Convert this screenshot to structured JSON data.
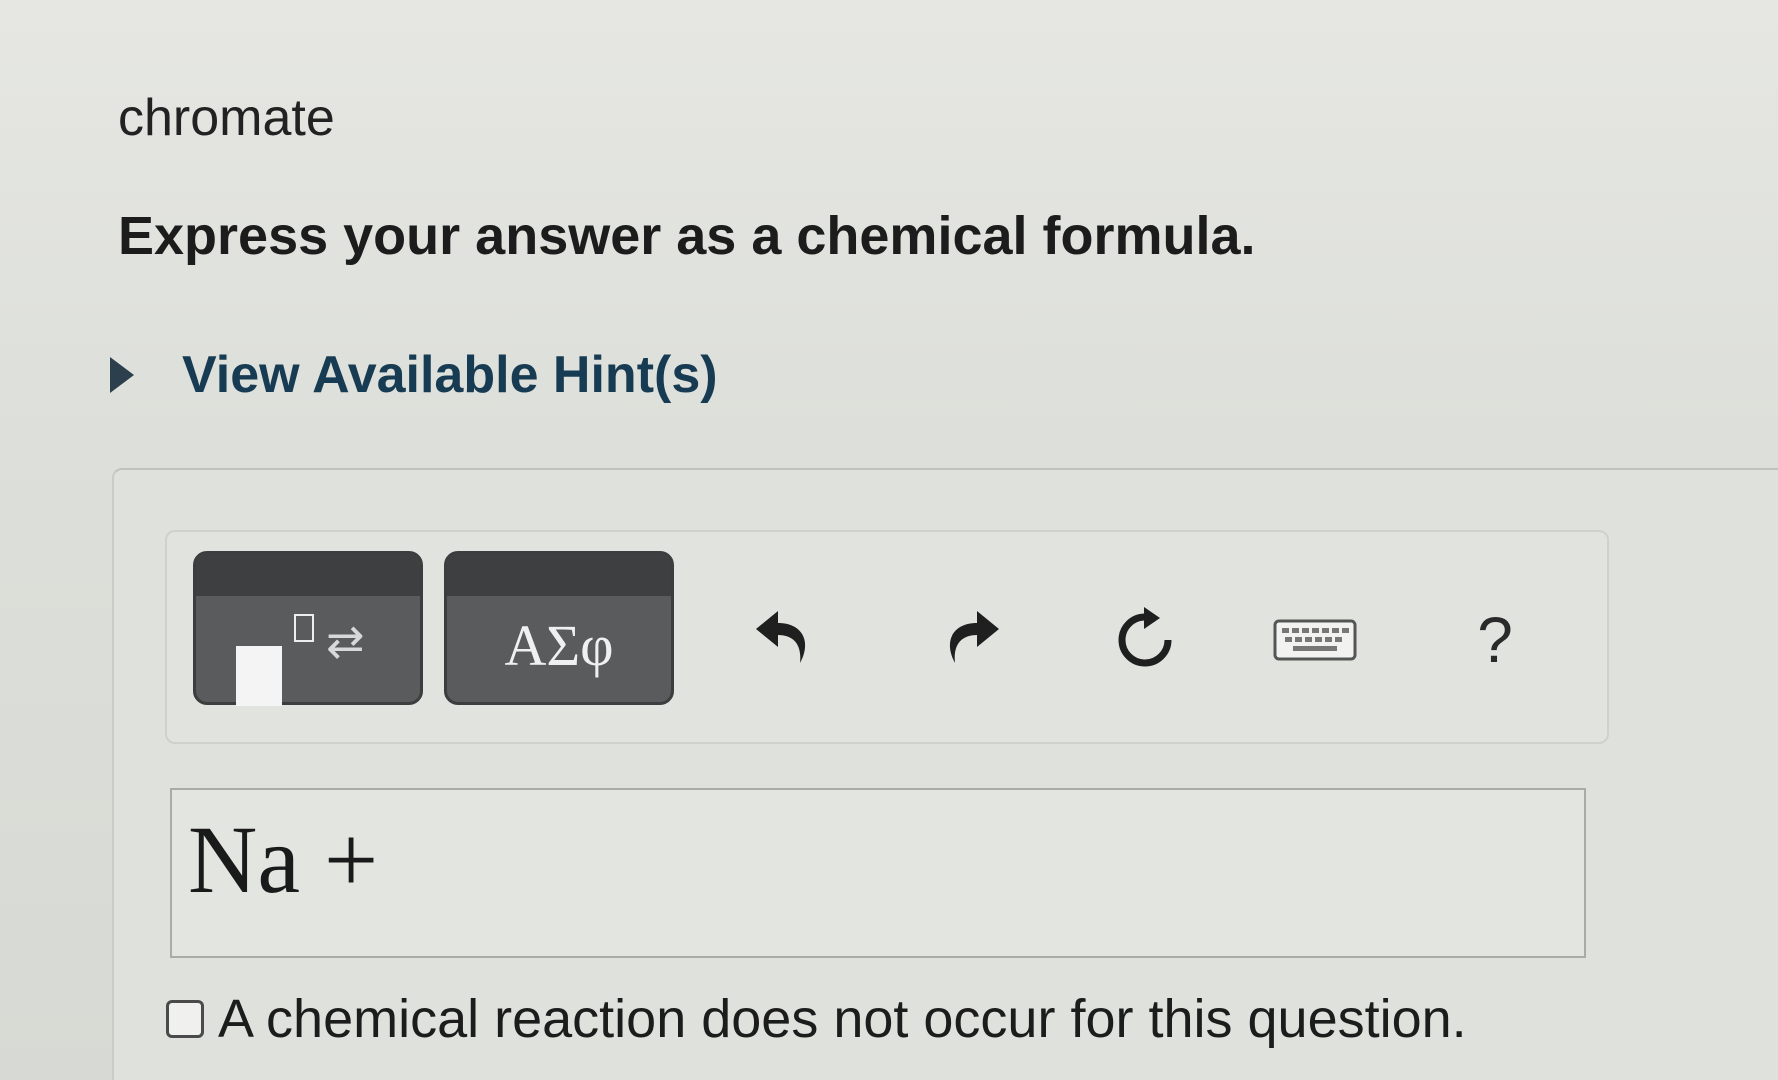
{
  "question": {
    "label": "chromate",
    "instruction": "Express your answer as a chemical formula.",
    "hint_link": "View Available Hint(s)"
  },
  "toolbar": {
    "templates_button": {
      "icon": "templates-icon"
    },
    "symbols_button": {
      "label": "ΑΣφ"
    },
    "undo": {
      "icon": "undo-icon"
    },
    "redo": {
      "icon": "redo-icon"
    },
    "reset": {
      "icon": "reset-icon"
    },
    "keyboard": {
      "icon": "keyboard-icon"
    },
    "help": {
      "label": "?"
    }
  },
  "answer": {
    "value": "Na +"
  },
  "no_reaction": {
    "label": "A chemical reaction does not occur for this question.",
    "checked": false
  },
  "colors": {
    "hint_link": "#173b52",
    "button_dark": "#5a5b5c"
  }
}
